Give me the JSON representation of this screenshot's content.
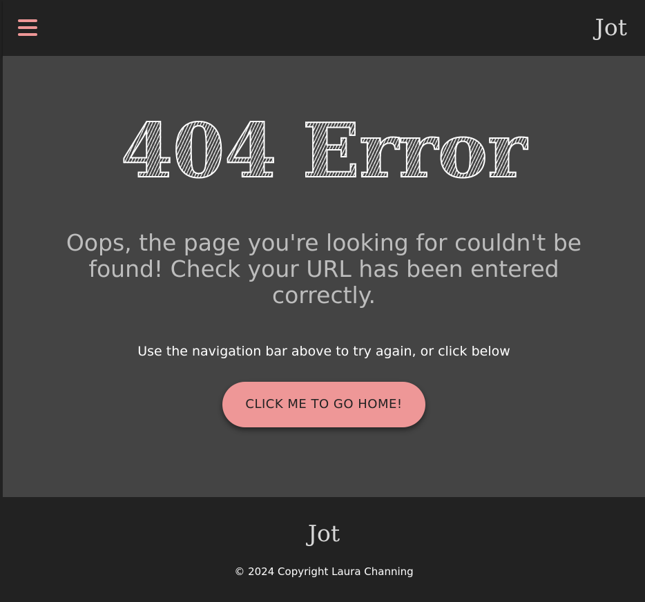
{
  "navbar": {
    "menu_icon": "hamburger-menu-icon",
    "brand": "Jot"
  },
  "main": {
    "headline": "404 Error",
    "message": "Oops, the page you're looking for couldn't be found! Check your URL has been entered correctly.",
    "hint": "Use the navigation bar above to try again, or click below",
    "home_button_label": "CLICK ME TO GO HOME!"
  },
  "footer": {
    "brand": "Jot",
    "copyright": "© 2024 Copyright Laura Channing"
  },
  "colors": {
    "accent": "#ee9797",
    "page_background": "#444444",
    "bar_background": "#222222",
    "muted_text": "#bdbdbd"
  }
}
